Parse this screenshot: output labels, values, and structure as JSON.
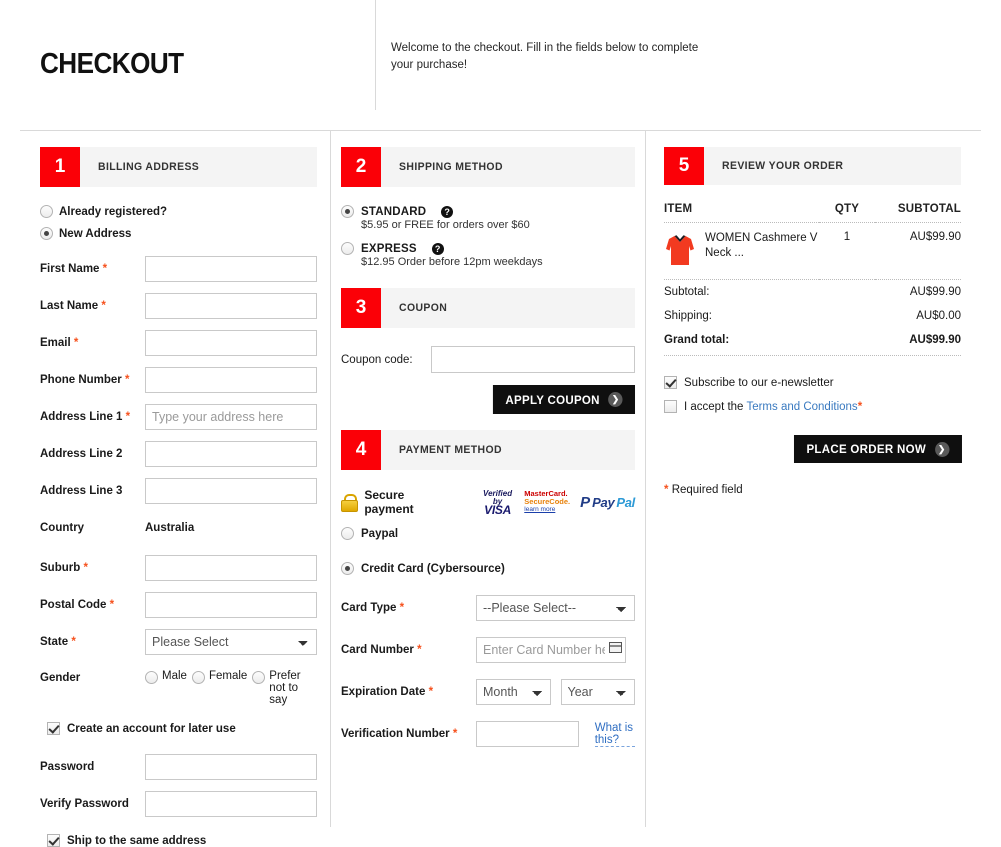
{
  "header": {
    "title": "CHECKOUT",
    "intro": "Welcome to the checkout. Fill in the fields below to complete your purchase!"
  },
  "billing": {
    "number": "1",
    "title": "BILLING ADDRESS",
    "options": [
      {
        "label": "Already registered?",
        "selected": false
      },
      {
        "label": "New Address",
        "selected": true
      }
    ],
    "fields": {
      "first_name": {
        "label": "First Name",
        "required": "*",
        "value": "",
        "placeholder": ""
      },
      "last_name": {
        "label": "Last Name",
        "required": "*",
        "value": "",
        "placeholder": ""
      },
      "email": {
        "label": "Email",
        "required": "*",
        "value": "",
        "placeholder": ""
      },
      "phone": {
        "label": "Phone Number",
        "required": "*",
        "value": "",
        "placeholder": ""
      },
      "address1": {
        "label": "Address Line 1",
        "required": "*",
        "value": "",
        "placeholder": "Type your address here"
      },
      "address2": {
        "label": "Address Line 2",
        "required": "",
        "value": "",
        "placeholder": ""
      },
      "address3": {
        "label": "Address Line 3",
        "required": "",
        "value": "",
        "placeholder": ""
      },
      "country": {
        "label": "Country",
        "value": "Australia"
      },
      "suburb": {
        "label": "Suburb",
        "required": "*",
        "value": "",
        "placeholder": ""
      },
      "postal": {
        "label": "Postal Code",
        "required": "*",
        "value": "",
        "placeholder": ""
      },
      "state": {
        "label": "State",
        "required": "*",
        "selected": "Please Select"
      },
      "gender": {
        "label": "Gender"
      },
      "password": {
        "label": "Password",
        "value": "",
        "placeholder": ""
      },
      "verify_password": {
        "label": "Verify Password",
        "value": "",
        "placeholder": ""
      }
    },
    "gender_options": [
      {
        "label": "Male",
        "selected": false
      },
      {
        "label": "Female",
        "selected": false
      },
      {
        "label": "Prefer not to say",
        "selected": false
      }
    ],
    "create_account": {
      "label": "Create an account for later use",
      "checked": true
    },
    "ship_same": {
      "label": "Ship to the same address",
      "checked": true
    }
  },
  "shipping": {
    "number": "2",
    "title": "SHIPPING METHOD",
    "help_glyph": "?",
    "methods": [
      {
        "name": "STANDARD",
        "desc": "$5.95 or FREE for orders over $60",
        "selected": true
      },
      {
        "name": "EXPRESS",
        "desc": "$12.95 Order before 12pm weekdays",
        "selected": false
      }
    ]
  },
  "coupon": {
    "number": "3",
    "title": "COUPON",
    "label": "Coupon code:",
    "value": "",
    "placeholder": "",
    "apply_label": "APPLY COUPON",
    "arrow": "❯"
  },
  "payment": {
    "number": "4",
    "title": "PAYMENT METHOD",
    "secure_label": "Secure payment",
    "badges": {
      "visa_top": "Verified by",
      "visa_main": "VISA",
      "mc_line1": "MasterCard.",
      "mc_line2": "SecureCode.",
      "mc_line3": "learn more",
      "paypal_p": "P",
      "paypal_pay": "Pay",
      "paypal_pal": "Pal"
    },
    "methods": [
      {
        "label": "Paypal",
        "selected": false
      },
      {
        "label": "Credit Card (Cybersource)",
        "selected": true
      }
    ],
    "fields": {
      "card_type": {
        "label": "Card Type",
        "required": "*",
        "selected": "--Please Select--"
      },
      "card_number": {
        "label": "Card Number",
        "required": "*",
        "value": "",
        "placeholder": "Enter Card Number here"
      },
      "expiration": {
        "label": "Expiration Date",
        "required": "*",
        "month": "Month",
        "year": "Year"
      },
      "verification": {
        "label": "Verification Number",
        "required": "*",
        "value": "",
        "placeholder": "",
        "help_link": "What is this?"
      }
    }
  },
  "review": {
    "number": "5",
    "title": "REVIEW YOUR ORDER",
    "columns": {
      "item": "ITEM",
      "qty": "QTY",
      "subtotal": "SUBTOTAL"
    },
    "items": [
      {
        "name": "WOMEN Cashmere V Neck ...",
        "qty": "1",
        "subtotal": "AU$99.90"
      }
    ],
    "totals": [
      {
        "label": "Subtotal:",
        "value": "AU$99.90",
        "bold": false
      },
      {
        "label": "Shipping:",
        "value": "AU$0.00",
        "bold": false
      },
      {
        "label": "Grand total:",
        "value": "AU$99.90",
        "bold": true
      }
    ],
    "newsletter": {
      "label": "Subscribe to our e-newsletter",
      "checked": true
    },
    "terms": {
      "prefix": "I accept the ",
      "link": "Terms and Conditions",
      "required": "*",
      "checked": false
    },
    "place_order_label": "PLACE ORDER NOW",
    "arrow": "❯",
    "required_note": "* Required field"
  },
  "colors": {
    "accent_red": "#fb0007",
    "required_orange": "#f6511d",
    "button_black": "#0f0f0f",
    "section_bg": "#f4f4f4",
    "link_blue": "#3a7ac0",
    "product_red": "#f23a20"
  }
}
